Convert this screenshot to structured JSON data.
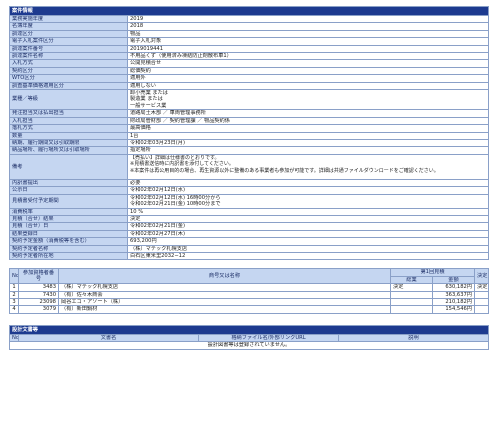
{
  "case_info": {
    "section_title": "案件情報",
    "rows": [
      {
        "label": "業務実施年度",
        "value": "2019"
      },
      {
        "label": "名簿年度",
        "value": "2018"
      },
      {
        "label": "調達区分",
        "value": "物品"
      },
      {
        "label": "電子入札案件区分",
        "value": "電子入札対象"
      },
      {
        "label": "調達案件番号",
        "value": "2019019441"
      },
      {
        "label": "調達案件名称",
        "value": "不用品くず（使用済み凍結防止剤散布車1）"
      },
      {
        "label": "入札方式",
        "value": "公開見積合せ"
      },
      {
        "label": "契約区分",
        "value": "総価契約"
      },
      {
        "label": "WTO区分",
        "value": "適用外"
      },
      {
        "label": "調査基準価格適用区分",
        "value": "適用しない"
      }
    ],
    "industry_label": "業種／等級",
    "industry_lines": [
      "卸小売業 または",
      "製造業 または",
      "一般サービス業"
    ],
    "rows2": [
      {
        "label": "発注担当又は払出担当",
        "value": "道路局土木部 ／ 車両管理事務所"
      },
      {
        "label": "入札担当",
        "value": "財政局管財部 ／ 契約管理課 ／ 物品契約係"
      },
      {
        "label": "落札方式",
        "value": "最高価格"
      },
      {
        "label": "数量",
        "value": "1台"
      },
      {
        "label": "納期、履行期間又は引取期限",
        "value": "令和02年03月23日(月)"
      },
      {
        "label": "納品場所、履行場所又は引取場所",
        "value": "指定場所"
      }
    ],
    "remarks_label": "備考",
    "remarks_lines": [
      "【売払い】詳細は仕様書のとおりです。",
      "※見積書送信時に内訳書を添付してください。",
      "※本案件は再公用目的の場合、再生資源以外に整備のある事業者も参加が可能です。詳細は共通ファイルダウンロードをご確認ください。"
    ],
    "rows3": [
      {
        "label": "内訳書提出",
        "value": "必要"
      },
      {
        "label": "公示日",
        "value": "令和02年02月12日(水)"
      }
    ],
    "period_label": "見積書受付予定期間",
    "period_lines": [
      "令和02年02月12日(水) 16時00分から",
      "令和02年02月21日(金) 10時00分まで"
    ],
    "rows4": [
      {
        "label": "消費税率",
        "value": "10 %"
      },
      {
        "label": "見積（合せ）結果",
        "value": "決定"
      },
      {
        "label": "見積（合せ）日",
        "value": "令和02年02月21日(金)"
      },
      {
        "label": "結果登録日",
        "value": "令和02年02月27日(木)"
      },
      {
        "label": "契約予定金額（消費税等を含む）",
        "value": "693,200円"
      },
      {
        "label": "契約予定者名称",
        "value": "（株）マテック札幌支店"
      },
      {
        "label": "契約予定者所在地",
        "value": "白石区東米里2032−12"
      }
    ]
  },
  "bidders": {
    "headers": {
      "no": "No",
      "reg_no": "参加資格者番号",
      "name": "商号又は名称",
      "round": "第1回見積",
      "sogo": "総業",
      "amount": "金額",
      "decision": "決定"
    },
    "rows": [
      {
        "no": "1",
        "reg_no": "3483",
        "name": "（株）マテック札幌支店",
        "sogo": "決定",
        "amount": "630,182円",
        "decision": "決定"
      },
      {
        "no": "2",
        "reg_no": "7430",
        "name": "（有）佐々木商会",
        "sogo": "",
        "amount": "363,637円",
        "decision": ""
      },
      {
        "no": "3",
        "reg_no": "23098",
        "name": "岡谷エコ・アソート（株）",
        "sogo": "",
        "amount": "210,182円",
        "decision": ""
      },
      {
        "no": "4",
        "reg_no": "3079",
        "name": "（有）新田鋼材",
        "sogo": "",
        "amount": "154,546円",
        "decision": ""
      }
    ]
  },
  "design_docs": {
    "section_title": "設計文書等",
    "headers": {
      "no": "No",
      "doc_name": "文書名",
      "file": "格納ファイル名/外部リンクURL",
      "note": "説明"
    },
    "empty_message": "設計図書等は登録されていません。"
  }
}
